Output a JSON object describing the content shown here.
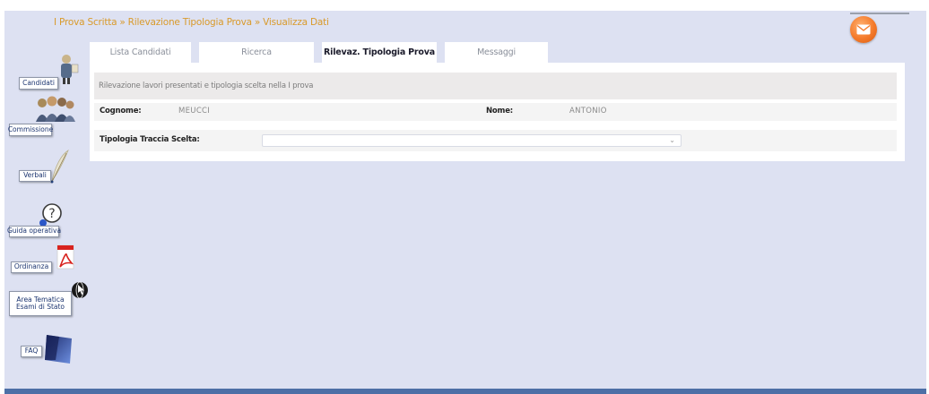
{
  "breadcrumb": {
    "items": [
      "I Prova Scritta",
      "Rilevazione Tipologia Prova",
      "Visualizza Dati"
    ],
    "separator": "»"
  },
  "tabs": [
    {
      "label": "Lista Candidati",
      "active": false
    },
    {
      "label": "Ricerca",
      "active": false
    },
    {
      "label": "Rilevaz. Tipologia Prova",
      "active": true
    },
    {
      "label": "Messaggi",
      "active": false
    }
  ],
  "main": {
    "description": "Rilevazione lavori presentati e tipologia scelta nella I prova",
    "cognome_label": "Cognome:",
    "cognome_value": "MEUCCI",
    "nome_label": "Nome:",
    "nome_value": "ANTONIO",
    "tipologia_label": "Tipologia Traccia Scelta:",
    "tipologia_value": "",
    "tipologia_caret": "⌄"
  },
  "sidebar": {
    "items": [
      {
        "label": "Candidati",
        "icon": "candidates-icon"
      },
      {
        "label": "Commissione",
        "icon": "commission-icon"
      },
      {
        "label": "Verbali",
        "icon": "quill-icon"
      },
      {
        "label": "Guida operativa",
        "icon": "help-icon"
      },
      {
        "label": "Ordinanza",
        "icon": "pdf-icon"
      },
      {
        "label": "Area Tematica Esami di Stato",
        "label_line1": "Area Tematica",
        "label_line2": "Esami di Stato",
        "icon": "globe-cursor-icon"
      },
      {
        "label": "FAQ",
        "icon": "faq-icon"
      }
    ]
  },
  "colors": {
    "background": "#dde1f2",
    "breadcrumb": "#d99a2b",
    "mail_icon": "#f47a2a",
    "bottom_bar": "#4d6fa6"
  }
}
